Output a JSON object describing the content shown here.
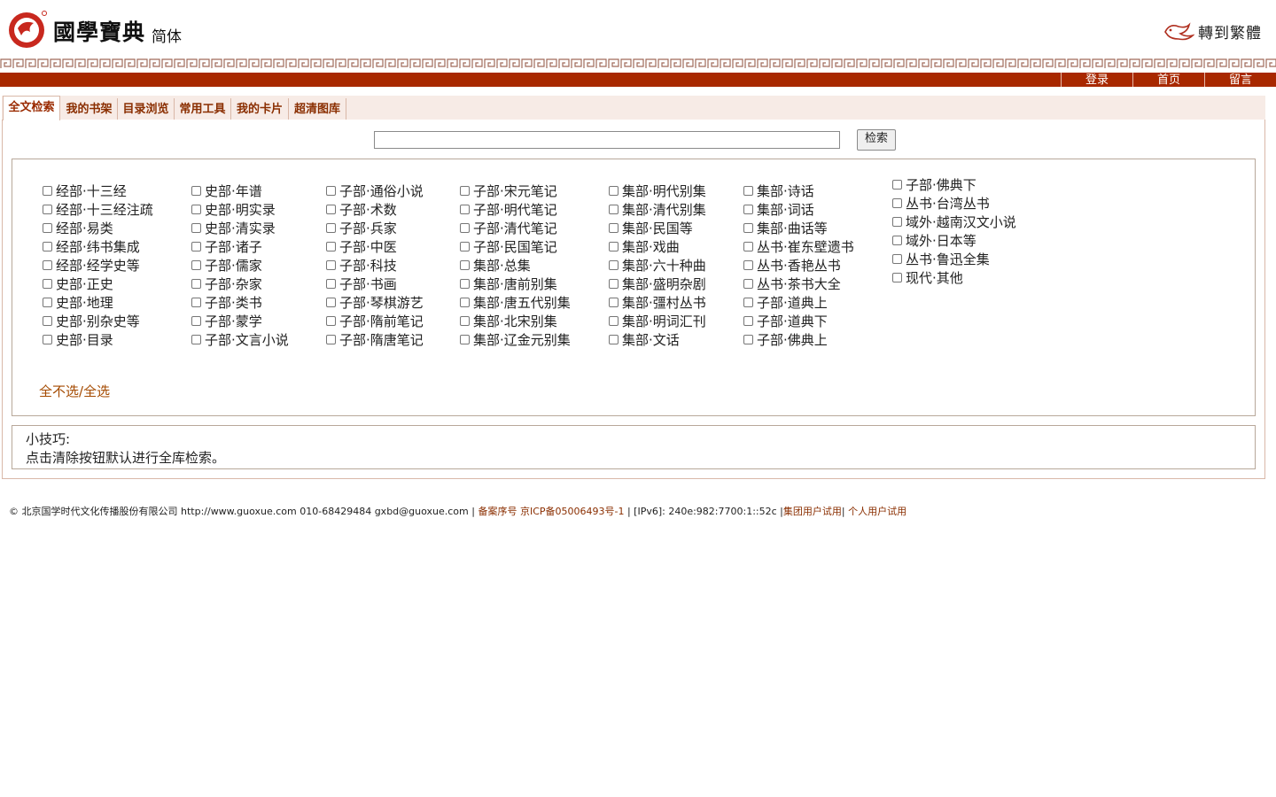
{
  "header": {
    "brand": "國學寶典",
    "brand_sub": "简体",
    "to_traditional": "轉到繁體"
  },
  "nav": {
    "login": "登录",
    "home": "首页",
    "message": "留言"
  },
  "tabs": [
    "全文检索",
    "我的书架",
    "目录浏览",
    "常用工具",
    "我的卡片",
    "超清图库"
  ],
  "search": {
    "value": "",
    "button": "检索"
  },
  "categories": [
    [
      "经部·十三经",
      "经部·十三经注疏",
      "经部·易类",
      "经部·纬书集成",
      "经部·经学史等",
      "史部·正史",
      "史部·地理",
      "史部·别杂史等",
      "史部·目录"
    ],
    [
      "史部·年谱",
      "史部·明实录",
      "史部·清实录",
      "子部·诸子",
      "子部·儒家",
      "子部·杂家",
      "子部·类书",
      "子部·蒙学",
      "子部·文言小说"
    ],
    [
      "子部·通俗小说",
      "子部·术数",
      "子部·兵家",
      "子部·中医",
      "子部·科技",
      "子部·书画",
      "子部·琴棋游艺",
      "子部·隋前笔记",
      "子部·隋唐笔记"
    ],
    [
      "子部·宋元笔记",
      "子部·明代笔记",
      "子部·清代笔记",
      "子部·民国笔记",
      "集部·总集",
      "集部·唐前别集",
      "集部·唐五代别集",
      "集部·北宋别集",
      "集部·辽金元别集"
    ],
    [
      "集部·明代别集",
      "集部·清代别集",
      "集部·民国等",
      "集部·戏曲",
      "集部·六十种曲",
      "集部·盛明杂剧",
      "集部·彊村丛书",
      "集部·明词汇刊",
      "集部·文话"
    ],
    [
      "集部·诗话",
      "集部·词话",
      "集部·曲话等",
      "丛书·崔东壁遗书",
      "丛书·香艳丛书",
      "丛书·茶书大全",
      "子部·道典上",
      "子部·道典下",
      "子部·佛典上"
    ],
    [
      "子部·佛典下",
      "丛书·台湾丛书",
      "域外·越南汉文小说",
      "域外·日本等",
      "丛书·鲁迅全集",
      "现代·其他"
    ]
  ],
  "select": {
    "none": "全不选",
    "sep": "/",
    "all": "全选"
  },
  "tips": {
    "title": "小技巧:",
    "text": "点击清除按钮默认进行全库检索。"
  },
  "footer": {
    "copyright": "© 北京国学时代文化传播股份有限公司 http://www.guoxue.com 010-68429484 gxbd@guoxue.com | ",
    "icp_label": "备案序号",
    "icp_number": "京ICP备05006493号-1",
    "ipv6": " | [IPv6]: 240e:982:7700:1::52c |",
    "group_trial": "集团用户试用",
    "sep": "| ",
    "personal_trial": "个人用户试用"
  },
  "colors": {
    "brand_red": "#a82800",
    "tab_text": "#8a2e00",
    "link": "#a44a00"
  }
}
